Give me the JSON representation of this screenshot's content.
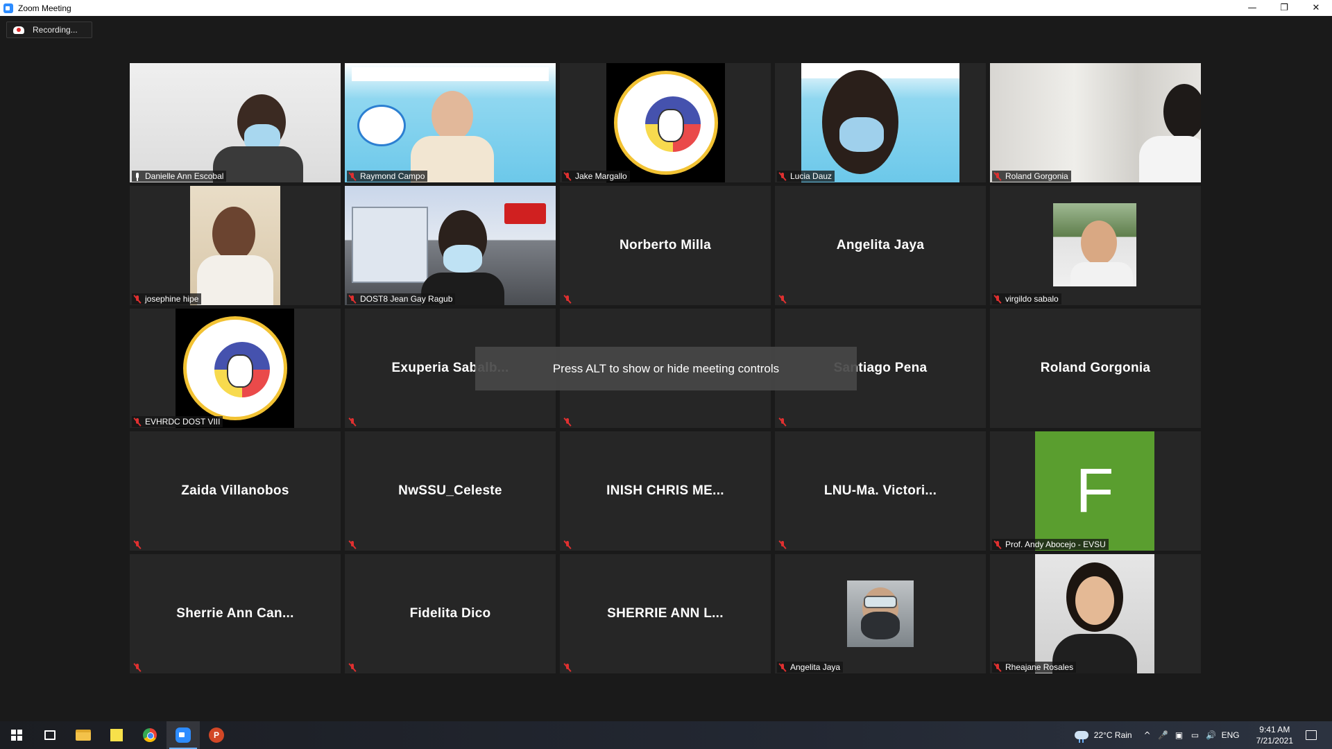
{
  "window": {
    "title": "Zoom Meeting",
    "minimize": "—",
    "restore": "❐",
    "close": "✕"
  },
  "recording": {
    "label": "Recording..."
  },
  "overlay": {
    "message": "Press ALT to show or hide meeting controls"
  },
  "tiles": [
    {
      "name": "Danielle Ann Escobal",
      "kind": "video",
      "muted": false,
      "active": true
    },
    {
      "name": "Raymond Campo",
      "kind": "video",
      "muted": true
    },
    {
      "name": "Jake Margallo",
      "kind": "logo",
      "muted": true
    },
    {
      "name": "Lucia Dauz",
      "kind": "video",
      "muted": true
    },
    {
      "name": "Roland Gorgonia",
      "kind": "video",
      "muted": true
    },
    {
      "name": "josephine hipe",
      "kind": "video",
      "muted": true
    },
    {
      "name": "DOST8 Jean Gay Ragub",
      "kind": "video",
      "muted": true
    },
    {
      "name": "Norberto Milla",
      "kind": "name",
      "muted": true
    },
    {
      "name": "Angelita Jaya",
      "kind": "name",
      "muted": true
    },
    {
      "name": "virgildo sabalo",
      "kind": "video",
      "muted": true
    },
    {
      "name": "EVHRDC DOST VIII",
      "kind": "logo",
      "muted": true
    },
    {
      "name": "Exuperia Sabalb...",
      "kind": "name",
      "muted": true
    },
    {
      "name": "",
      "kind": "name",
      "muted": true
    },
    {
      "name": "Santiago Pena",
      "kind": "name",
      "muted": true
    },
    {
      "name": "Roland Gorgonia",
      "kind": "name",
      "muted": false
    },
    {
      "name": "Zaida Villanobos",
      "kind": "name",
      "muted": true
    },
    {
      "name": "NwSSU_Celeste",
      "kind": "name",
      "muted": true
    },
    {
      "name": "INISH CHRIS ME...",
      "kind": "name",
      "muted": true
    },
    {
      "name": "LNU-Ma. Victori...",
      "kind": "name",
      "muted": true
    },
    {
      "name": "Prof. Andy Abocejo - EVSU",
      "kind": "avatar",
      "initial": "F",
      "muted": true
    },
    {
      "name": "Sherrie Ann Can...",
      "kind": "name",
      "muted": true
    },
    {
      "name": "Fidelita Dico",
      "kind": "name",
      "muted": true
    },
    {
      "name": "SHERRIE ANN L...",
      "kind": "name",
      "muted": true
    },
    {
      "name": "Angelita Jaya",
      "kind": "video",
      "muted": true
    },
    {
      "name": "Rheajane Rosales",
      "kind": "video",
      "muted": true
    }
  ],
  "taskbar": {
    "weather": "22°C  Rain",
    "language": "ENG",
    "time": "9:41 AM",
    "date": "7/21/2021",
    "ppt_letter": "P"
  },
  "colors": {
    "active_speaker_border": "#c6ea4a",
    "muted_icon": "#e03030",
    "avatar_green": "#5a9e2f",
    "tile_bg": "#262626"
  }
}
